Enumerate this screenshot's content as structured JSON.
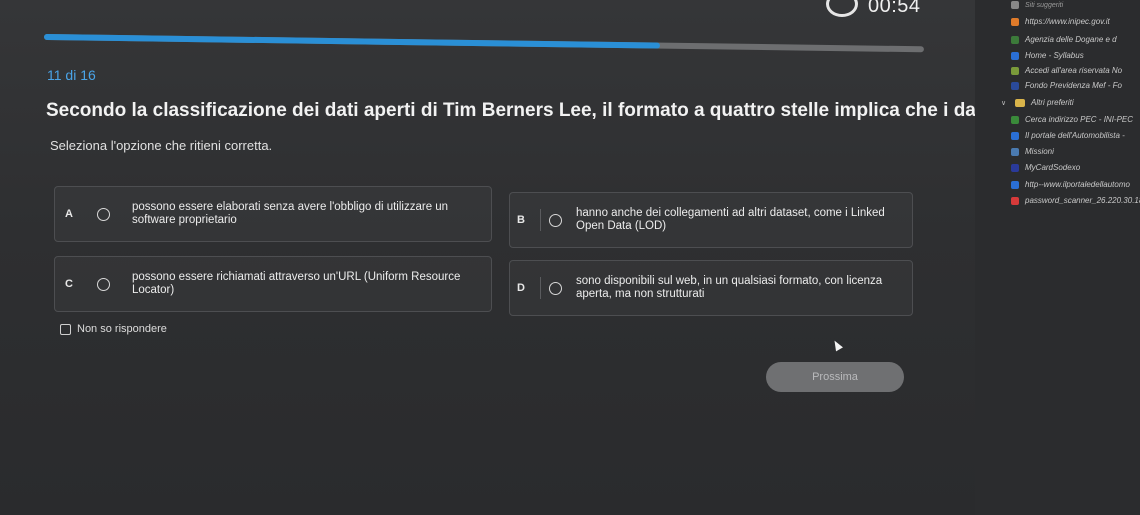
{
  "quiz": {
    "timer": "00:54",
    "progress_fraction": 0.7,
    "counter": "11 di 16",
    "question": "Secondo la classificazione dei dati aperti di Tim Berners Lee, il formato a quattro stelle implica che i dati...",
    "instruction": "Seleziona l'opzione che ritieni corretta.",
    "options": [
      {
        "letter": "A",
        "text": "possono essere elaborati senza avere l'obbligo di utilizzare un software proprietario"
      },
      {
        "letter": "B",
        "text": "hanno anche dei collegamenti ad altri dataset, come i Linked Open Data (LOD)"
      },
      {
        "letter": "C",
        "text": "possono essere richiamati attraverso un'URL (Uniform Resource Locator)"
      },
      {
        "letter": "D",
        "text": "sono disponibili sul web, in un qualsiasi formato, con licenza aperta, ma non strutturati"
      }
    ],
    "skip_label": "Non so rispondere",
    "next_label": "Prossima"
  },
  "sidebar": {
    "top_label": "Siti suggeriti",
    "items": [
      {
        "label": "https://www.inipec.gov.it",
        "icon": "inipec-favicon",
        "color": "#e07b2a"
      },
      {
        "label": "Agenzia delle Dogane e d",
        "icon": "dogane-favicon",
        "color": "#3c7a3a"
      },
      {
        "label": "Home - Syllabus",
        "icon": "syllabus-favicon",
        "color": "#2a6fd6"
      },
      {
        "label": "Accedi all'area riservata No",
        "icon": "noipa-favicon",
        "color": "#7a9a3a"
      },
      {
        "label": "Fondo Previdenza Mef - Fo",
        "icon": "mef-favicon",
        "color": "#2a4a9a"
      },
      {
        "label": "Altri preferiti",
        "icon": "folder-icon",
        "color": "#d9b44a"
      },
      {
        "label": "Cerca indirizzo PEC - INI-PEC",
        "icon": "inipec-favicon",
        "color": "#3a8a3a"
      },
      {
        "label": "Il portale dell'Automobilista -",
        "icon": "automobilista-favicon",
        "color": "#2a6fd6"
      },
      {
        "label": "Missioni",
        "icon": "missioni-favicon",
        "color": "#4a7ab0"
      },
      {
        "label": "MyCardSodexo",
        "icon": "sodexo-favicon",
        "color": "#2a3a9a"
      },
      {
        "label": "http--www.ilportaledellautomo",
        "icon": "automobilista-favicon",
        "color": "#2a6fd6"
      },
      {
        "label": "password_scanner_26.220.30.18",
        "icon": "scanner-favicon",
        "color": "#d63a3a"
      }
    ]
  }
}
